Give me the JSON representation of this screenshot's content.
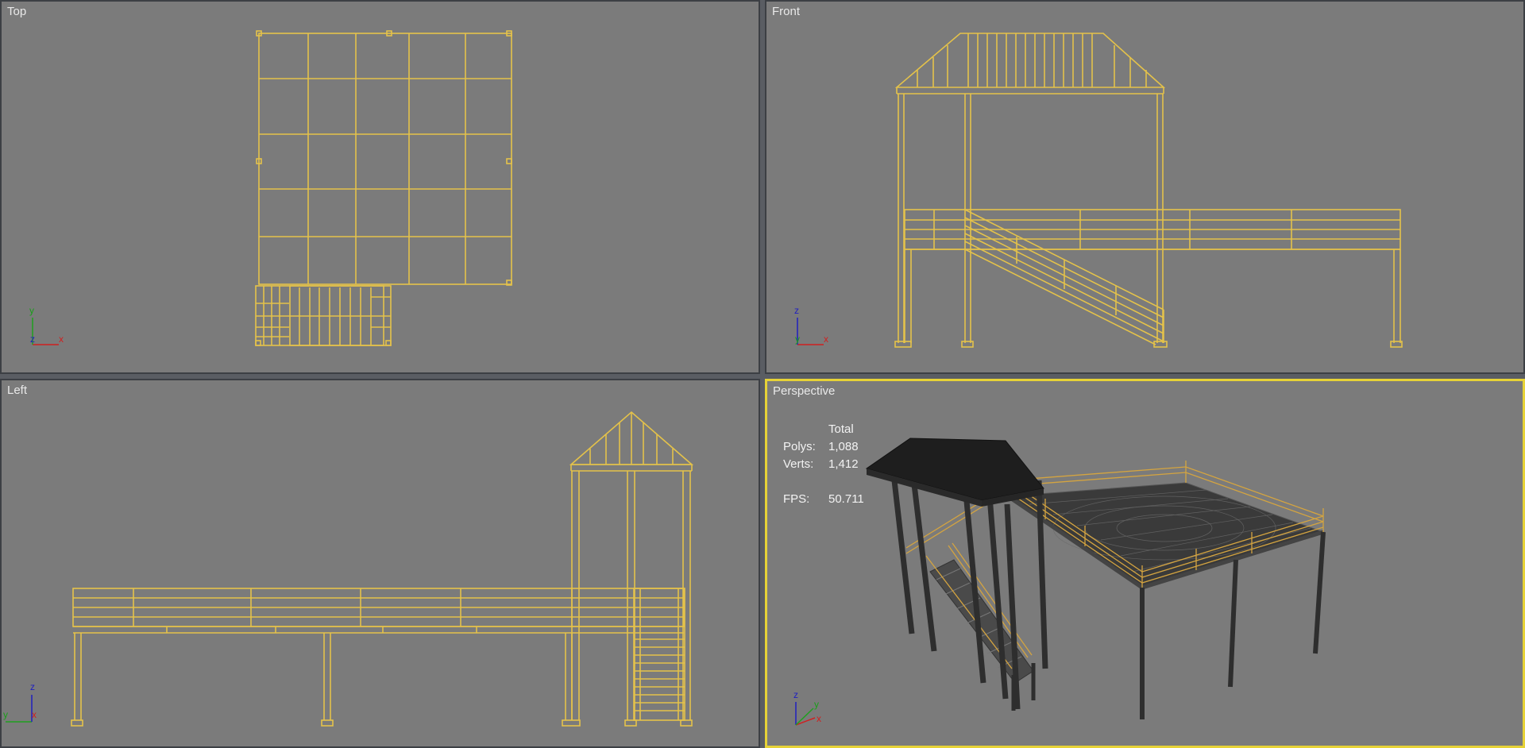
{
  "viewports": {
    "top": {
      "label": "Top"
    },
    "front": {
      "label": "Front"
    },
    "left": {
      "label": "Left"
    },
    "perspective": {
      "label": "Perspective"
    }
  },
  "stats": {
    "header": "Total",
    "polys_label": "Polys:",
    "polys_value": "1,088",
    "verts_label": "Verts:",
    "verts_value": "1,412",
    "fps_label": "FPS:",
    "fps_value": "50.711"
  },
  "axes": {
    "top": {
      "h": "x",
      "v": "y",
      "c": "z"
    },
    "front": {
      "h": "x",
      "v": "z",
      "c": "y"
    },
    "left": {
      "h": "x",
      "v": "z",
      "c": "y"
    },
    "perspective": {
      "h": "x",
      "v": "z",
      "c": "y"
    }
  },
  "colors": {
    "wireframe": "#e4c24a",
    "viewport_bg": "#7b7b7b",
    "active_border": "#e6d237",
    "axis_x": "#d02020",
    "axis_y": "#20a020",
    "axis_z": "#2020c0"
  }
}
